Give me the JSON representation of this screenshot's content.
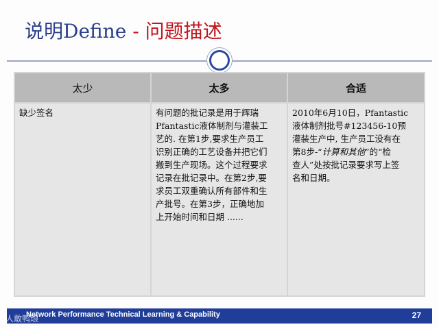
{
  "title": {
    "prefix": "说明Define",
    "dash": " - ",
    "main": "问题描述"
  },
  "table": {
    "headers": [
      "太少",
      "太多",
      "合适"
    ],
    "col1": "缺少签名",
    "col2_lines": [
      "有问题的批记录是用于辉瑞",
      "Pfantastic液体制剂与灌装工",
      "艺的. 在第1步,要求生产员工",
      "识别正确的工艺设备并把它们",
      "搬到生产现场。这个过程要求",
      "记录在批记录中。在第2步,要",
      "求员工双重确认所有部件和生",
      "产批号。在第3步，正确地加",
      "上开始时间和日期 ......"
    ],
    "col3_line1": "2010年6月10日，Pfantastic",
    "col3_line2": "液体制剂批号#123456-10预",
    "col3_line3": "灌装生产中, 生产员工没有在",
    "col3_line4_a": "第8步-“",
    "col3_line4_b": "计算和其他",
    "col3_line4_c": "”的“检",
    "col3_line5": "查人”处按批记录要求写上签",
    "col3_line6": "名和日期。"
  },
  "footer": {
    "text": "Network Performance Technical Learning & Capability",
    "page": "27"
  },
  "watermark": "人敢鸭琅"
}
